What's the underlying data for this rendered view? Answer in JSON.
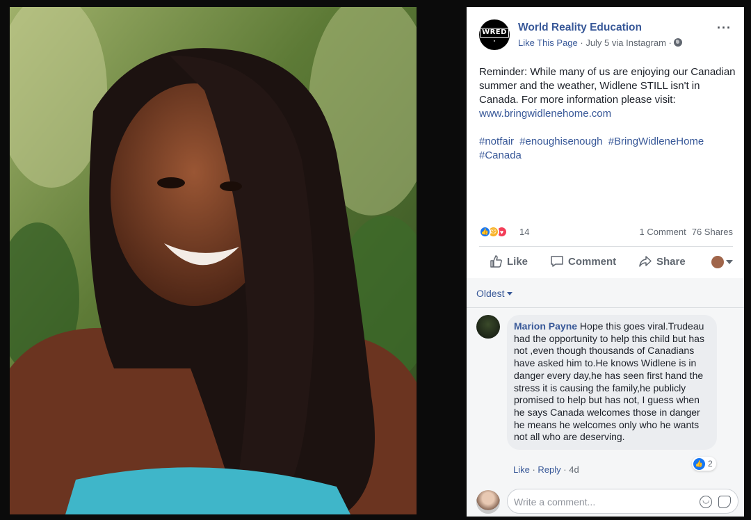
{
  "page": {
    "name": "World Reality Education",
    "logo_text": "WRED",
    "like_page": "Like This Page",
    "meta_rest": " · July 5 via Instagram · ",
    "more_label": "···"
  },
  "post": {
    "text": "Reminder: While many of us are enjoying our Canadian summer and the weather, Widlene STILL isn't in Canada. For more information please visit: ",
    "link": "www.bringwidlenehome.com",
    "hashtags": [
      "#notfair",
      "#enoughisenough",
      "#BringWidleneHome",
      "#Canada"
    ]
  },
  "reactions": {
    "count": "14",
    "comments": "1 Comment",
    "shares": "76 Shares",
    "icons": [
      "like-icon",
      "sad-icon",
      "love-icon"
    ]
  },
  "actions": {
    "like": "Like",
    "comment": "Comment",
    "share": "Share"
  },
  "sort": {
    "label": "Oldest"
  },
  "comment": {
    "author": "Marion Payne",
    "text": " Hope this goes viral.Trudeau had the opportunity to help this child but has not ,even though thousands of Canadians have asked him to.He knows Widlene is in danger every day,he has seen first hand the stress it is causing the family,he publicly promised to help but has not, I guess when he says Canada welcomes those in danger he means he welcomes only who he wants not all who are deserving.",
    "like_count": "2",
    "like_label": "Like",
    "reply_label": "Reply",
    "age": "4d",
    "sep": " · "
  },
  "write": {
    "placeholder": "Write a comment..."
  },
  "colors": {
    "link": "#385898",
    "like_blue": "#1877f2",
    "background": "#0b0b0b"
  }
}
